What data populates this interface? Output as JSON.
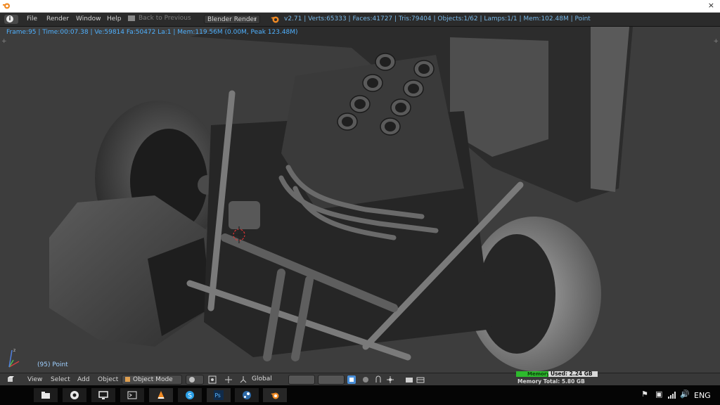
{
  "window": {
    "close_glyph": "×"
  },
  "info_header": {
    "editor_icon": "i",
    "menus": [
      "File",
      "Render",
      "Window",
      "Help"
    ],
    "back_label": "Back to Previous",
    "render_engine": "Blender Render",
    "stats": "v2.71 | Verts:65333 | Faces:41727 | Tris:79404 | Objects:1/62 | Lamps:1/1 | Mem:102.48M | Point"
  },
  "viewport": {
    "render_status": "Frame:95 | Time:00:07.38 | Ve:59814 Fa:50472 La:1 | Mem:119.56M (0.00M, Peak 123.48M)",
    "frame_label": "(95) Point",
    "axis": {
      "x": "x",
      "y": "y",
      "z": "z"
    }
  },
  "view_header": {
    "menus": [
      "View",
      "Select",
      "Add",
      "Object"
    ],
    "mode": "Object Mode",
    "orientation": "Global"
  },
  "memory": {
    "bar_label": "Memory",
    "used": "Used: 2.24 GB",
    "total": "Memory Total: 5.80 GB"
  },
  "taskbar": {
    "apps": [
      "file-explorer-icon",
      "chrome-icon",
      "desktop-icon",
      "command-prompt-icon",
      "vlc-icon",
      "skype-icon",
      "photoshop-icon",
      "steam-icon",
      "blender-icon"
    ],
    "photoshop_label": "Ps",
    "language": "ENG",
    "accent": "#4a8fd8"
  },
  "colors": {
    "status_blue": "#4fb1ff",
    "stats_blue": "#78b8e8",
    "viewport_bg": "#3d3d3d",
    "memory_green": "#2dba2d"
  }
}
